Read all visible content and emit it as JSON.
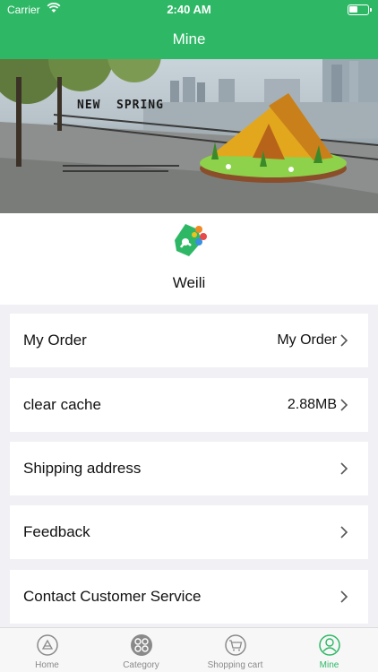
{
  "status_bar": {
    "carrier": "Carrier",
    "time": "2:40 AM"
  },
  "nav": {
    "title": "Mine"
  },
  "banner": {
    "text_new": "NEW",
    "text_spring": "SPRING"
  },
  "profile": {
    "username": "Weili"
  },
  "menu": {
    "items": [
      {
        "label": "My Order",
        "value": "My Order"
      },
      {
        "label": "clear cache",
        "value": "2.88MB"
      },
      {
        "label": "Shipping address",
        "value": ""
      },
      {
        "label": "Feedback",
        "value": ""
      },
      {
        "label": "Contact Customer Service",
        "value": ""
      }
    ]
  },
  "tab_bar": {
    "tabs": [
      {
        "label": "Home",
        "icon": "home-icon"
      },
      {
        "label": "Category",
        "icon": "category-icon"
      },
      {
        "label": "Shopping cart",
        "icon": "shopping-cart-icon"
      },
      {
        "label": "Mine",
        "icon": "mine-icon"
      }
    ],
    "active_index": 3
  },
  "colors": {
    "accent": "#2eb866",
    "tab_inactive": "#8a8a8a",
    "background": "#f0f0f5"
  }
}
